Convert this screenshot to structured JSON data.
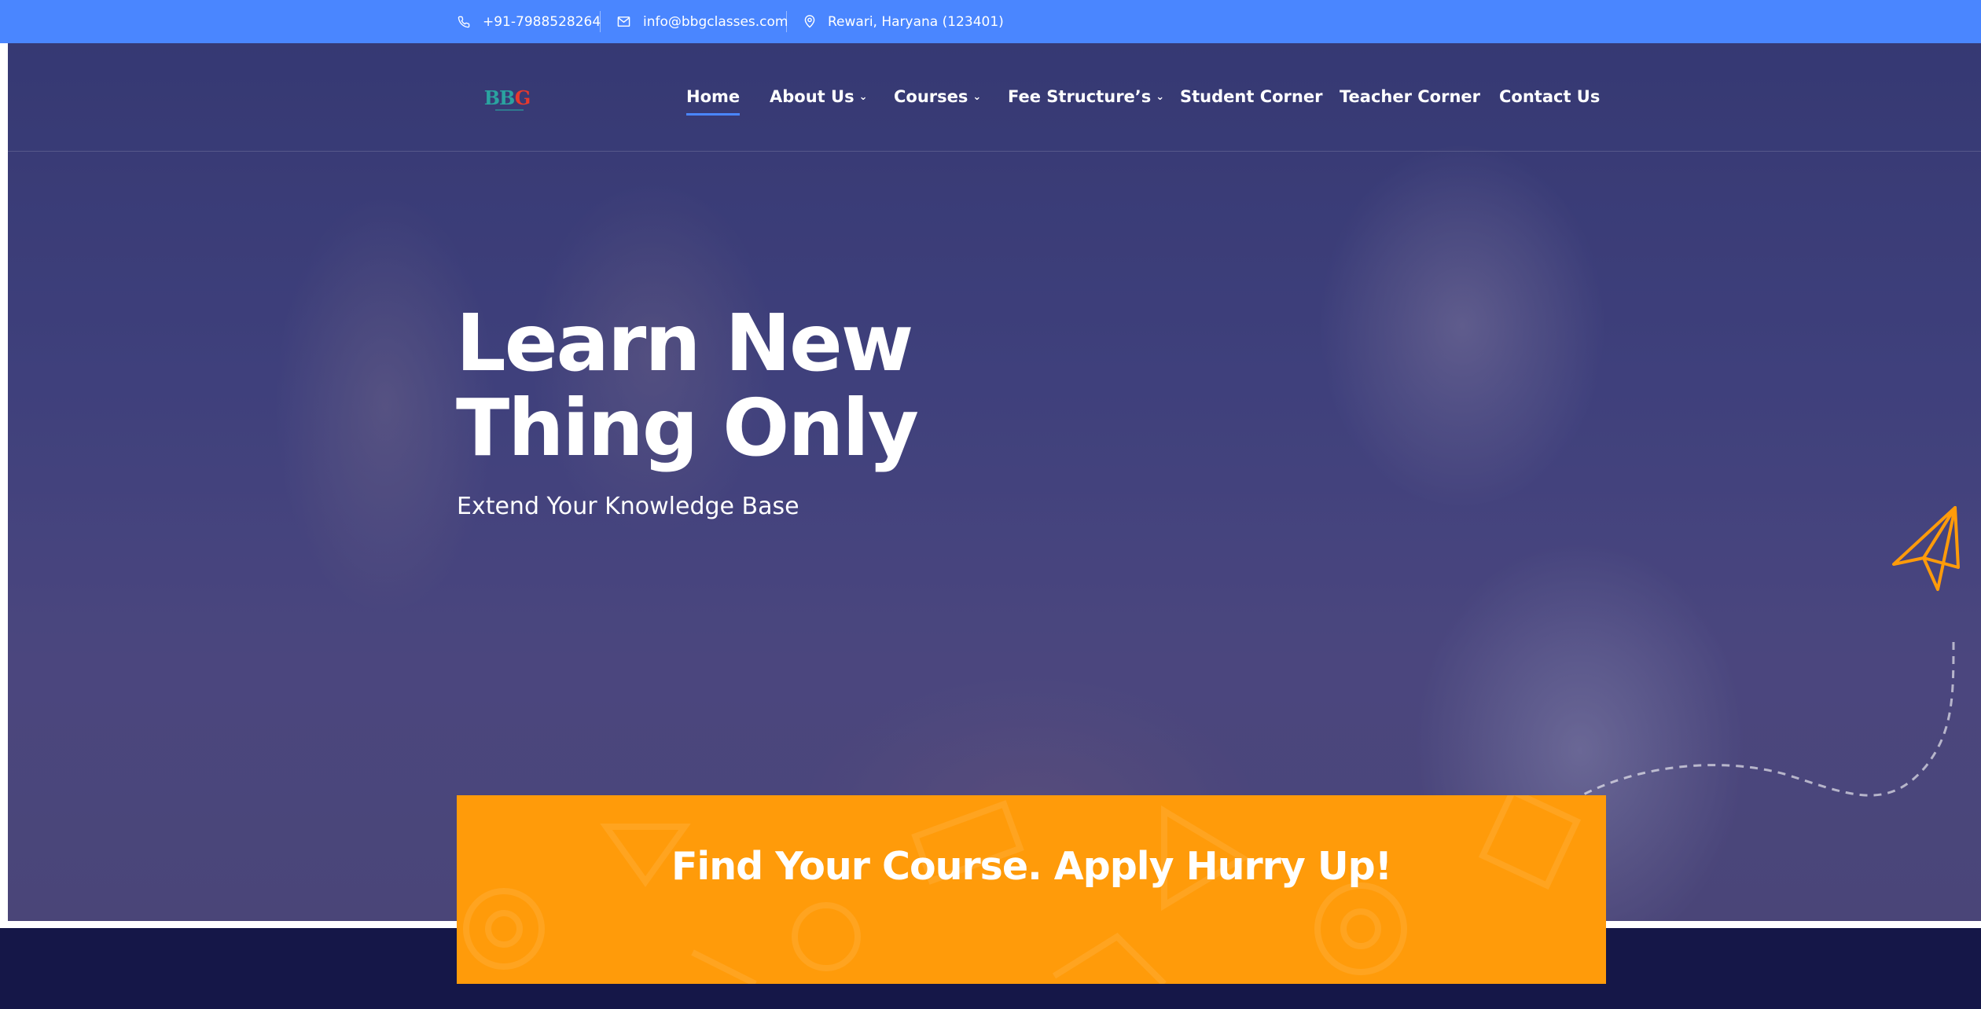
{
  "topbar": {
    "phone": "+91-7988528264",
    "email": "info@bbgclasses.com",
    "address": "Rewari, Haryana (123401)"
  },
  "logo": {
    "text_main": "BB",
    "text_accent": "G"
  },
  "nav": {
    "home": "Home",
    "about": "About Us",
    "courses": "Courses",
    "fee": "Fee Structure’s",
    "student": "Student Corner",
    "teacher": "Teacher Corner",
    "contact": "Contact Us"
  },
  "hero": {
    "title_line1": "Learn New",
    "title_line2": "Thing Only",
    "subtitle": "Extend Your Knowledge Base"
  },
  "cta": {
    "title": "Find Your Course. Apply Hurry Up!"
  },
  "colors": {
    "topbar": "#4a86ff",
    "accent_orange": "#ff9b0a",
    "dark_band": "#151748",
    "nav_active_underline": "#4a86ff"
  },
  "icons": [
    "phone-icon",
    "mail-icon",
    "location-pin-icon",
    "chevron-down-icon",
    "paper-plane-icon"
  ]
}
